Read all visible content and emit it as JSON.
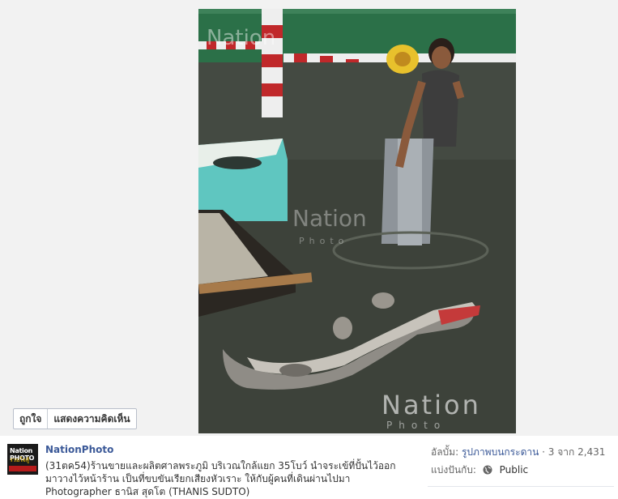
{
  "photo": {
    "watermark_brand": "Nation",
    "watermark_sub": "Photo",
    "subject_icons": [
      "flooded-street",
      "man-wading",
      "stuffed-crocodile",
      "boat"
    ]
  },
  "actions": {
    "like": "ถูกใจ",
    "comment": "แสดงความคิดเห็น"
  },
  "post": {
    "avatar_text": "Nation PHOTO",
    "avatar_sub": "ร่วมใจสู้วิกฤตชาติ",
    "page_name": "NationPhoto",
    "caption_line1": "(31ตค54)ร้านขายและผลิตศาลพระภูมิ บริเวณใกล้แยก 35โบว์ นำจระเข้ที่ปั้นไว้ออก",
    "caption_line2": "มาวางไว้หน้าร้าน เป็นที่ขบขันเรียกเสียงหัวเราะ ให้กับผู้คนที่เดินผ่านไปมา",
    "caption_line3": "Photographer ธานิส สุดโต (THANIS SUDTO)"
  },
  "meta": {
    "album_label": "อัลบั้ม:",
    "album_name": "รูปภาพบนกระดาน",
    "album_position": "· 3 จาก 2,431",
    "share_label": "แบ่งปันกับ:",
    "share_value": "Public"
  },
  "colors": {
    "link": "#3b5998",
    "page_bg": "#f2f2f2",
    "water": "#3d423a"
  }
}
